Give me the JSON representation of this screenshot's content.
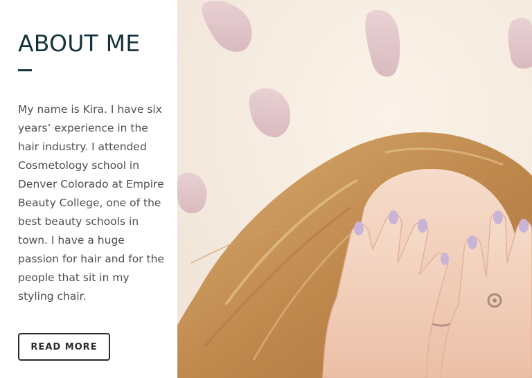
{
  "about": {
    "heading": "ABOUT ME",
    "bio": "My name is Kira. I have six years’ experience in the hair industry. I attended Cosmetology school in Denver Colorado at Empire Beauty College, one of the best beauty schools in town. I have a huge passion for hair and for the people that sit in my styling chair.",
    "button_label": "READ MORE"
  },
  "photo": {
    "subject": "woman-covering-face-with-hands-icon"
  },
  "colors": {
    "heading": "#16333b",
    "body_text": "#4d4d4d",
    "button_border": "#2b2b2b",
    "photo_background": "#f3e8df",
    "paint_swatch": "#d9b8c0",
    "hair": "#c89a5e",
    "skin": "#f0cdb7",
    "nail_polish": "#c9b3d6"
  }
}
